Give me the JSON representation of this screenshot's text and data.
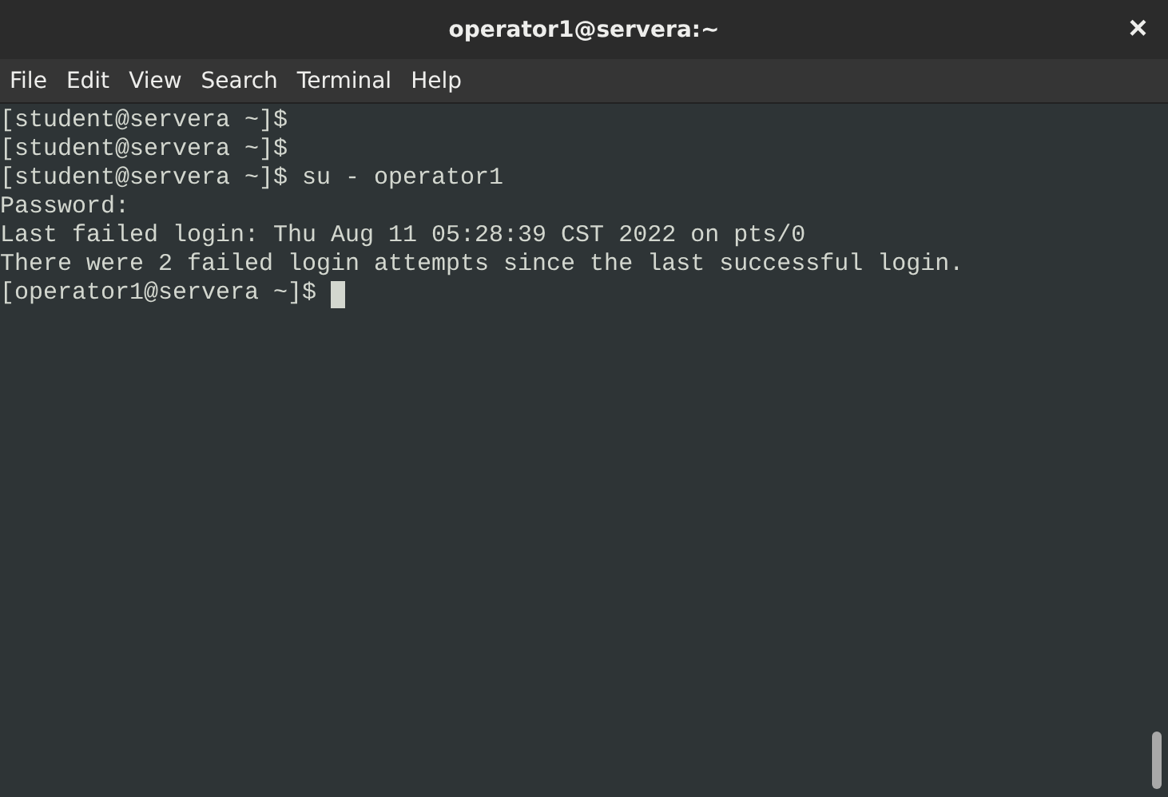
{
  "window": {
    "title": "operator1@servera:~",
    "close": "×"
  },
  "menu": [
    "File",
    "Edit",
    "View",
    "Search",
    "Terminal",
    "Help"
  ],
  "terminal": {
    "lines": [
      "[student@servera ~]$",
      "[student@servera ~]$",
      "[student@servera ~]$ su - operator1",
      "Password:",
      "Last failed login: Thu Aug 11 05:28:39 CST 2022 on pts/0",
      "There were 2 failed login attempts since the last successful login."
    ],
    "prompt": "[operator1@servera ~]$ "
  }
}
